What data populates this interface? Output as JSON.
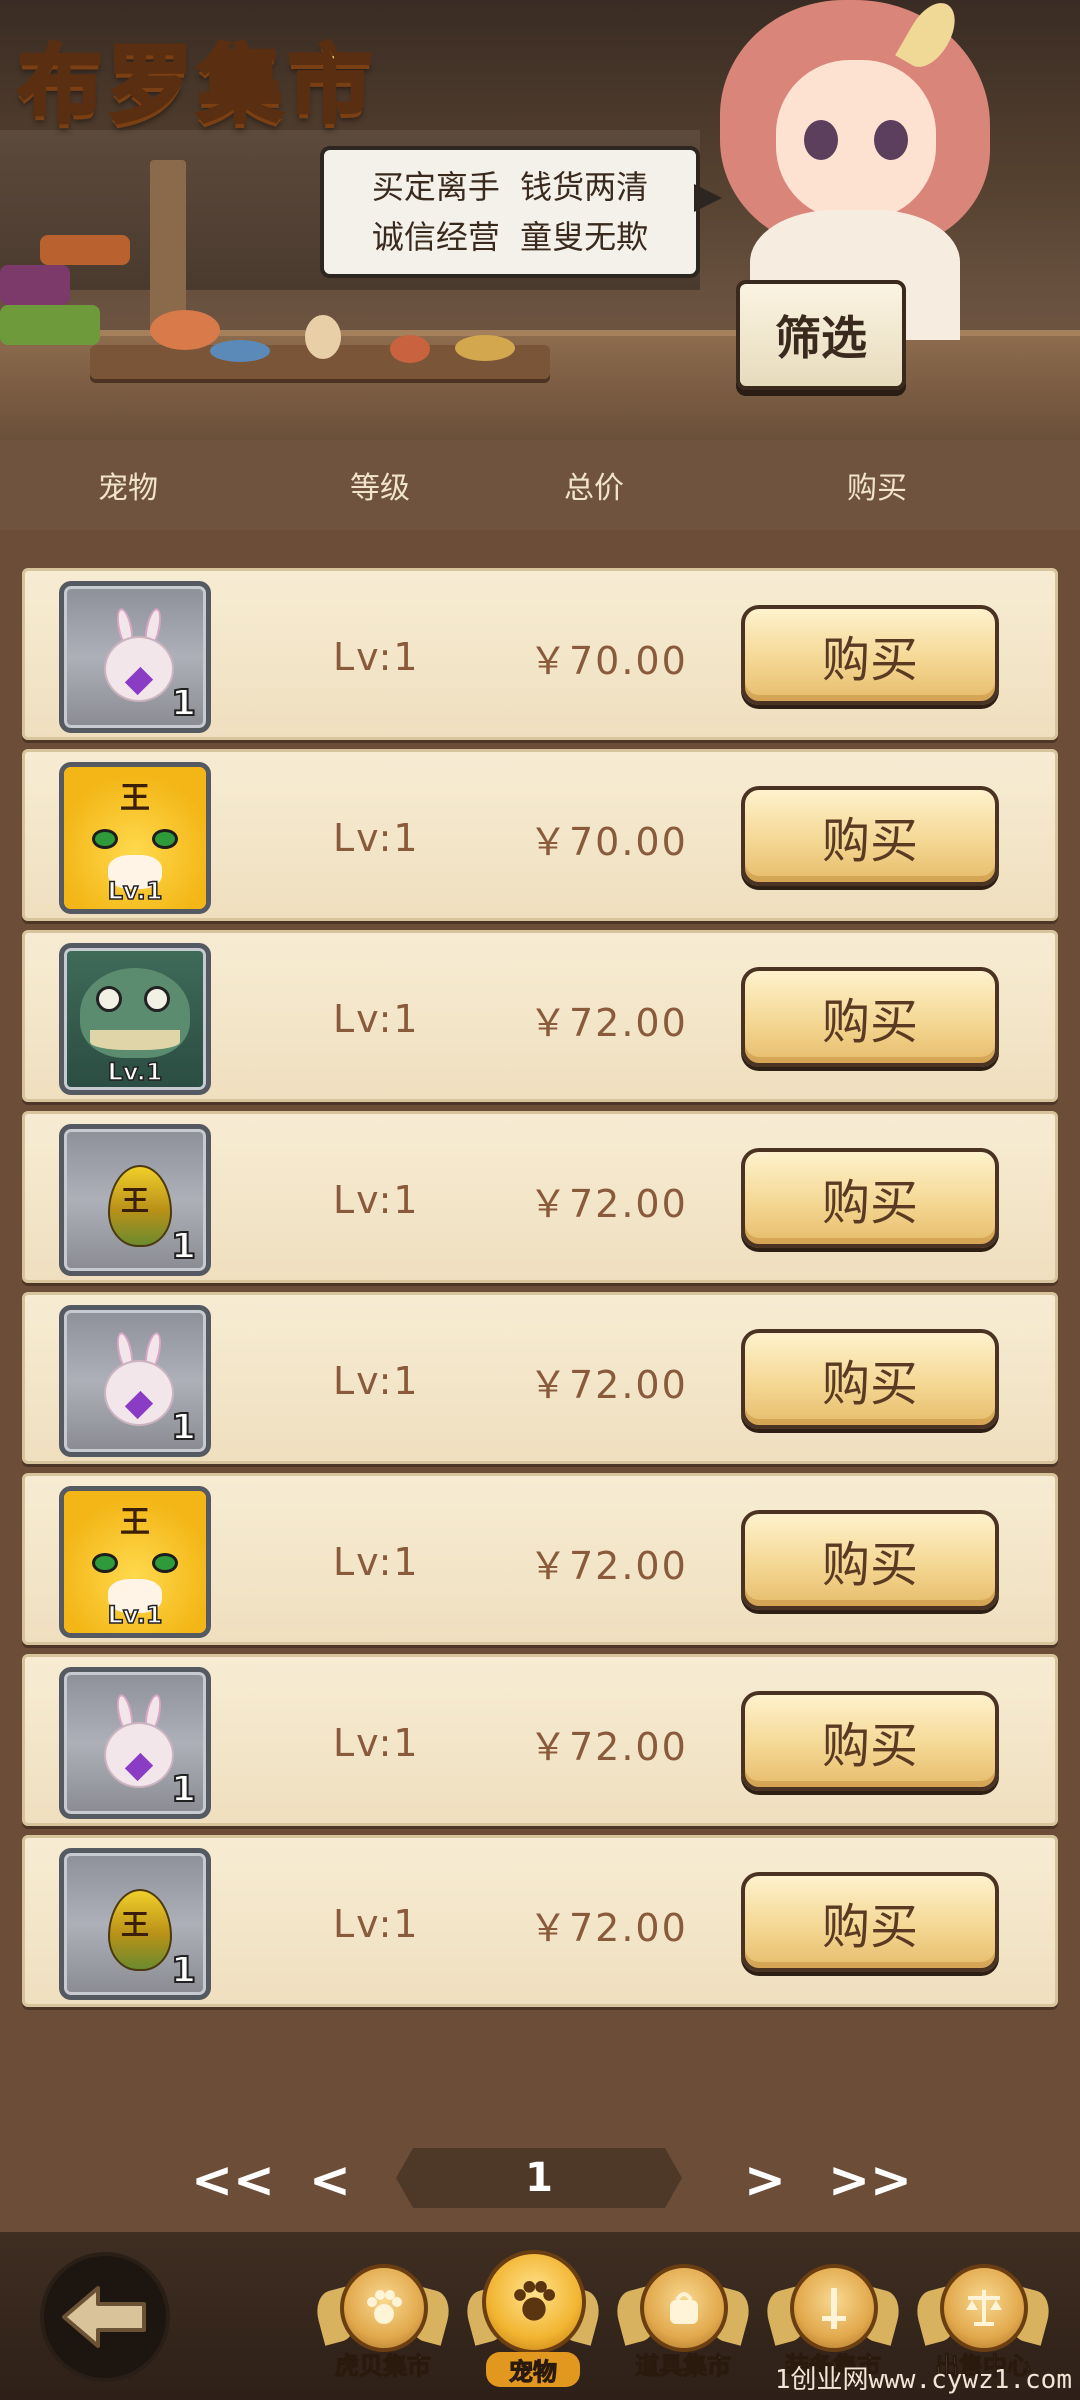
{
  "header": {
    "title": "布罗集市",
    "slogan_line1": "买定离手  钱货两清",
    "slogan_line2": "诚信经营  童叟无欺",
    "filter_label": "筛选"
  },
  "columns": {
    "pet": "宠物",
    "level": "等级",
    "total_price": "总价",
    "buy": "购买"
  },
  "listings": [
    {
      "pet_icon": "rabbit-pet-icon",
      "thumb_text": "1",
      "level": "Lv:1",
      "price": "￥70.00",
      "buy_label": "购买"
    },
    {
      "pet_icon": "tiger-pet-icon",
      "thumb_text": "Lv.1",
      "level": "Lv:1",
      "price": "￥70.00",
      "buy_label": "购买"
    },
    {
      "pet_icon": "dinosaur-pet-icon",
      "thumb_text": "Lv.1",
      "level": "Lv:1",
      "price": "￥72.00",
      "buy_label": "购买"
    },
    {
      "pet_icon": "tiger-egg-icon",
      "thumb_text": "1",
      "level": "Lv:1",
      "price": "￥72.00",
      "buy_label": "购买"
    },
    {
      "pet_icon": "rabbit-pet-icon",
      "thumb_text": "1",
      "level": "Lv:1",
      "price": "￥72.00",
      "buy_label": "购买"
    },
    {
      "pet_icon": "tiger-pet-icon",
      "thumb_text": "Lv.1",
      "level": "Lv:1",
      "price": "￥72.00",
      "buy_label": "购买"
    },
    {
      "pet_icon": "rabbit-pet-icon",
      "thumb_text": "1",
      "level": "Lv:1",
      "price": "￥72.00",
      "buy_label": "购买"
    },
    {
      "pet_icon": "tiger-egg-icon",
      "thumb_text": "1",
      "level": "Lv:1",
      "price": "￥72.00",
      "buy_label": "购买"
    }
  ],
  "pager": {
    "first": "<<",
    "prev": "<",
    "current_page": "1",
    "next": ">",
    "last": ">>"
  },
  "bottom_nav": {
    "back_icon": "back-arrow-icon",
    "items": [
      {
        "label": "虎贝集市",
        "icon": "paw-badge-icon",
        "active": false
      },
      {
        "label": "宠物",
        "icon": "paw-badge-icon",
        "active": true
      },
      {
        "label": "道具集市",
        "icon": "bag-badge-icon",
        "active": false
      },
      {
        "label": "装备集市",
        "icon": "sword-badge-icon",
        "active": false
      },
      {
        "label": "出售中心",
        "icon": "scale-badge-icon",
        "active": false
      }
    ]
  },
  "watermark": "1创业网www.cywz1.com",
  "colors": {
    "background": "#6b4d38",
    "row_bg": "#f7ecd3",
    "button_gold": "#f3d58f",
    "text_brown": "#8a5a3c",
    "title_gold": "#ffd24a"
  }
}
